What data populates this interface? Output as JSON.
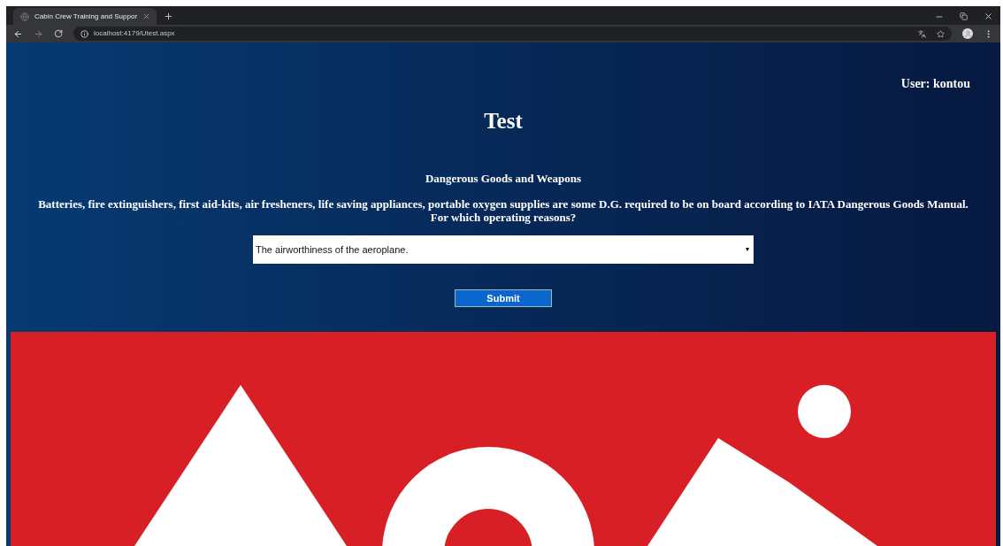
{
  "browser": {
    "tab_title": "Cabin Crew Training and Suppor",
    "address": "localhost:4179/Utest.aspx"
  },
  "user": "User: kontou",
  "title": "Test",
  "category": "Dangerous Goods and Weapons",
  "question": "Batteries, fire extinguishers, first aid-kits, air fresheners, life saving appliances, portable oxygen supplies are some D.G. required to be on board according to IATA Dangerous Goods Manual. For which operating reasons?",
  "answer_select": {
    "value": "The airworthiness of the aeroplane."
  },
  "submit": "Submit"
}
